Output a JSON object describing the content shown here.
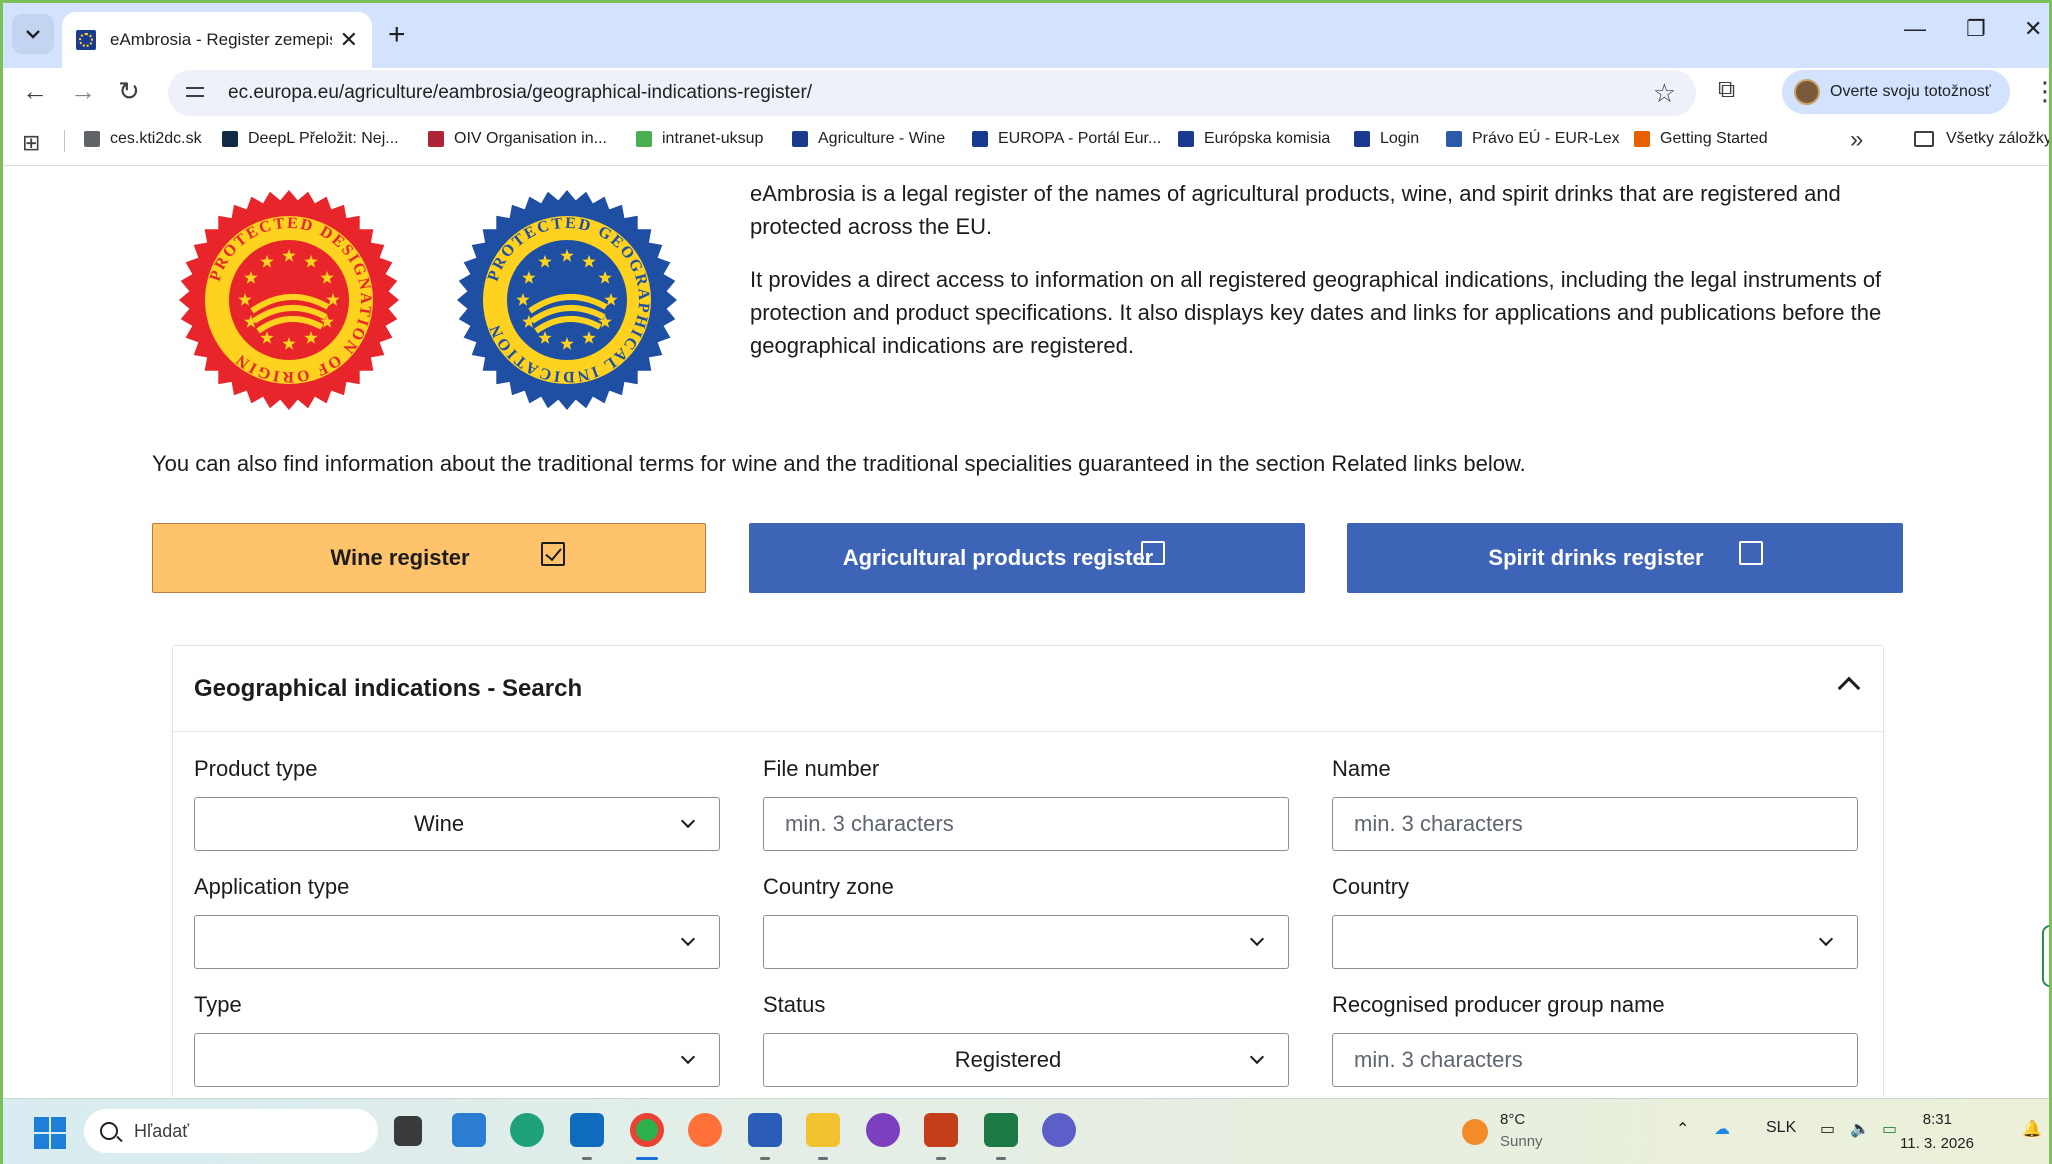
{
  "browser": {
    "tab": {
      "title": "eAmbrosia - Register zemepisn",
      "close": "✕"
    },
    "new_tab": "+",
    "window_controls": {
      "minimize": "—",
      "restore": "❐",
      "close": "✕"
    },
    "nav": {
      "back": "←",
      "forward": "→",
      "reload": "↻"
    },
    "url": "ec.europa.eu/agriculture/eambrosia/geographical-indications-register/",
    "profile_label": "Overte svoju totožnosť",
    "bookmarks": [
      {
        "label": "ces.kti2dc.sk",
        "icon": "page-icon",
        "color": "#5f6368"
      },
      {
        "label": "DeepL Přeložit: Nej...",
        "icon": "deepl-icon",
        "color": "#0f2b46"
      },
      {
        "label": "OIV Organisation in...",
        "icon": "oiv-icon",
        "color": "#b0243a"
      },
      {
        "label": "intranet-uksup",
        "icon": "leaf-icon",
        "color": "#4caf50"
      },
      {
        "label": "Agriculture - Wine",
        "icon": "eu-flag-icon",
        "color": "#1a3a8f"
      },
      {
        "label": "EUROPA - Portál Eur...",
        "icon": "eu-flag-icon",
        "color": "#1a3a8f"
      },
      {
        "label": "Európska komisia",
        "icon": "eu-flag-icon",
        "color": "#1a3a8f"
      },
      {
        "label": "Login",
        "icon": "eu-flag-icon",
        "color": "#1a3a8f"
      },
      {
        "label": "Právo EÚ - EUR-Lex",
        "icon": "eurlex-icon",
        "color": "#2a5aa8"
      },
      {
        "label": "Getting Started",
        "icon": "firefox-icon",
        "color": "#e66000"
      }
    ],
    "bookmarks_more": "»",
    "all_bookmarks": "Všetky záložky"
  },
  "page": {
    "seals": [
      {
        "name": "pdo-seal",
        "text": "PROTECTED DESIGNATION OF ORIGIN",
        "outer": "#e8252b",
        "inner": "#e8252b",
        "ring": "#ffd21f",
        "star": "#ffd21f"
      },
      {
        "name": "pgi-seal",
        "text": "PROTECTED GEOGRAPHICAL INDICATION",
        "outer": "#1e4fa3",
        "inner": "#1e4fa3",
        "ring": "#ffd21f",
        "star": "#ffd21f"
      }
    ],
    "intro_1": "eAmbrosia is a legal register of the names of agricultural products, wine, and spirit drinks that are registered and protected across the EU.",
    "intro_2": "It provides a direct access to information on all registered geographical indications, including the legal instruments of protection and product specifications. It also displays key dates and links for applications and publications before the geographical indications are registered.",
    "also_info": "You can also find information about the traditional terms for wine and the traditional specialities guaranteed in the section Related links below.",
    "registers": [
      {
        "label": "Wine register",
        "checked": true
      },
      {
        "label": "Agricultural products register",
        "checked": false
      },
      {
        "label": "Spirit drinks register",
        "checked": false
      }
    ],
    "search": {
      "title": "Geographical indications - Search",
      "fields": {
        "product_type": {
          "label": "Product type",
          "value": "Wine"
        },
        "file_number": {
          "label": "File number",
          "placeholder": "min. 3 characters"
        },
        "name": {
          "label": "Name",
          "placeholder": "min. 3 characters"
        },
        "application_type": {
          "label": "Application type",
          "value": ""
        },
        "country_zone": {
          "label": "Country zone",
          "value": ""
        },
        "country": {
          "label": "Country",
          "value": ""
        },
        "type": {
          "label": "Type",
          "value": ""
        },
        "status": {
          "label": "Status",
          "value": "Registered"
        },
        "producer_group": {
          "label": "Recognised producer group name",
          "placeholder": "min. 3 characters"
        }
      }
    }
  },
  "taskbar": {
    "search_placeholder": "Hľadať",
    "weather": {
      "temp": "8°C",
      "desc": "Sunny"
    },
    "language": "SLK",
    "time": "8:31",
    "date": "11. 3. 2026"
  }
}
